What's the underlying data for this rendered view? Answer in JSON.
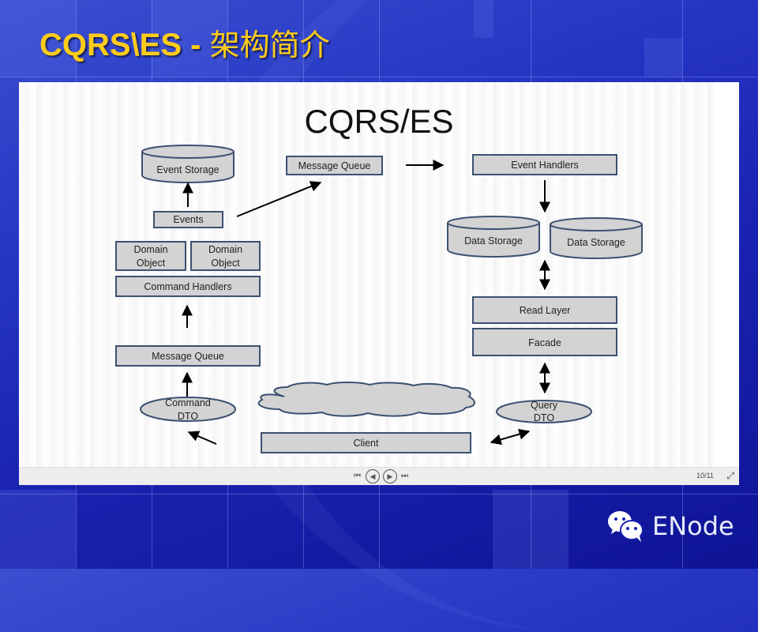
{
  "slide": {
    "title_en": "CQRS\\ES - ",
    "title_cn": "架构简介"
  },
  "diagram": {
    "title": "CQRS/ES",
    "nodes": {
      "event_storage": "Event Storage",
      "message_queue_top": "Message Queue",
      "event_handlers": "Event Handlers",
      "events": "Events",
      "domain_object_1": [
        "Domain",
        "Object"
      ],
      "domain_object_2": [
        "Domain",
        "Object"
      ],
      "command_handlers": "Command Handlers",
      "message_queue_left": "Message Queue",
      "command_dto": [
        "Command",
        "DTO"
      ],
      "data_storage_1": "Data Storage",
      "data_storage_2": "Data Storage",
      "read_layer": "Read Layer",
      "facade": "Facade",
      "query_dto": [
        "Query",
        "DTO"
      ],
      "client": "Client"
    },
    "colors": {
      "fill": "#d3d3d3",
      "stroke": "#3b5170",
      "arrow": "#000000"
    }
  },
  "viewer": {
    "first_icon": "skip-first-icon",
    "prev_icon": "prev-icon",
    "next_icon": "next-icon",
    "last_icon": "skip-last-icon",
    "page_indicator": "10/11",
    "fullscreen_icon": "fullscreen-exit-icon"
  },
  "branding": {
    "logo_icon": "wechat-icon",
    "name": "ENode"
  },
  "theme": {
    "title_color": "#ffcc1a",
    "background": "#1a22b0"
  }
}
